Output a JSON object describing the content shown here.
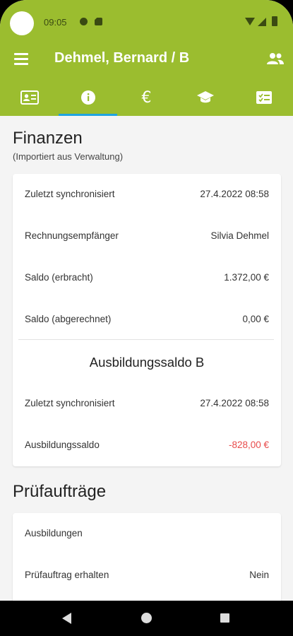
{
  "status_bar": {
    "time": "09:05",
    "icons": [
      "camera-cutout",
      "dnd-icon",
      "sd-card-icon",
      "wifi-icon",
      "signal-icon",
      "battery-icon"
    ]
  },
  "app_bar": {
    "title": "Dehmel, Bernard / B",
    "menu_icon": "menu-icon",
    "action_icon": "people-icon"
  },
  "tabs": {
    "items": [
      {
        "icon": "contact-card-icon"
      },
      {
        "icon": "info-icon",
        "selected": true
      },
      {
        "icon": "euro-icon",
        "glyph": "€"
      },
      {
        "icon": "graduation-cap-icon"
      },
      {
        "icon": "checklist-icon"
      }
    ]
  },
  "finanzen": {
    "title": "Finanzen",
    "subtitle": "(Importiert aus Verwaltung)",
    "rows": [
      {
        "label": "Zuletzt synchronisiert",
        "value": "27.4.2022 08:58"
      },
      {
        "label": "Rechnungsempfänger",
        "value": "Silvia Dehmel"
      },
      {
        "label": "Saldo (erbracht)",
        "value": "1.372,00 €"
      },
      {
        "label": "Saldo (abgerechnet)",
        "value": "0,00 €"
      }
    ],
    "ausbildung_heading": "Ausbildungssaldo B",
    "ausbildung_rows": [
      {
        "label": "Zuletzt synchronisiert",
        "value": "27.4.2022 08:58"
      },
      {
        "label": "Ausbildungssaldo",
        "value": "-828,00 €"
      }
    ]
  },
  "pruefauftraege": {
    "title": "Prüfaufträge",
    "rows": [
      {
        "label": "Ausbildungen",
        "value": ""
      },
      {
        "label": "Prüfauftrag erhalten",
        "value": "Nein"
      }
    ]
  },
  "colors": {
    "primary": "#9bbd2f",
    "tab_indicator": "#1ea4e0",
    "negative": "#e84a4a"
  }
}
